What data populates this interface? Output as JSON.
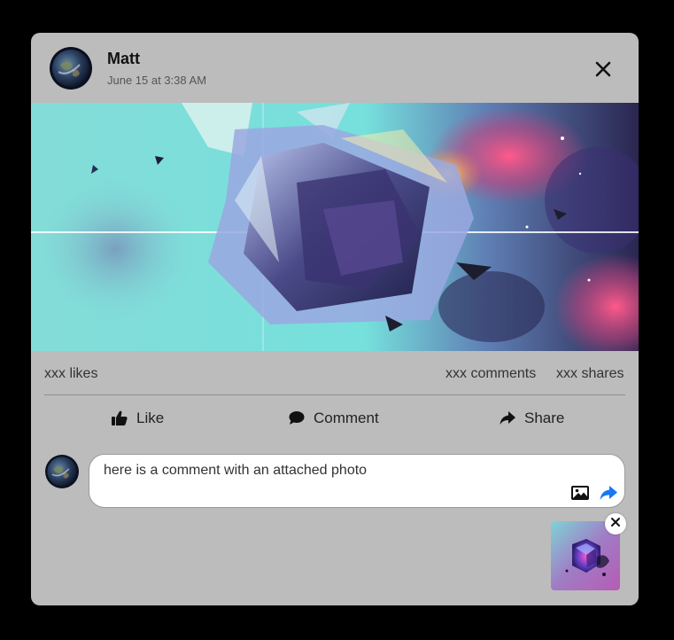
{
  "post": {
    "author": "Matt",
    "timestamp": "June 15 at 3:38 AM"
  },
  "stats": {
    "likes": "xxx likes",
    "comments": "xxx comments",
    "shares": "xxx shares"
  },
  "actions": {
    "like": "Like",
    "comment": "Comment",
    "share": "Share"
  },
  "comment_input": {
    "value": "here is a comment with an attached photo"
  },
  "icons": {
    "close": "close-icon",
    "like": "thumbs-up-icon",
    "comment": "speech-bubble-icon",
    "share": "share-arrow-icon",
    "photo": "image-icon",
    "send": "send-arrow-icon"
  },
  "colors": {
    "card_background": "#bcbcbc",
    "send_accent": "#1877f2"
  }
}
